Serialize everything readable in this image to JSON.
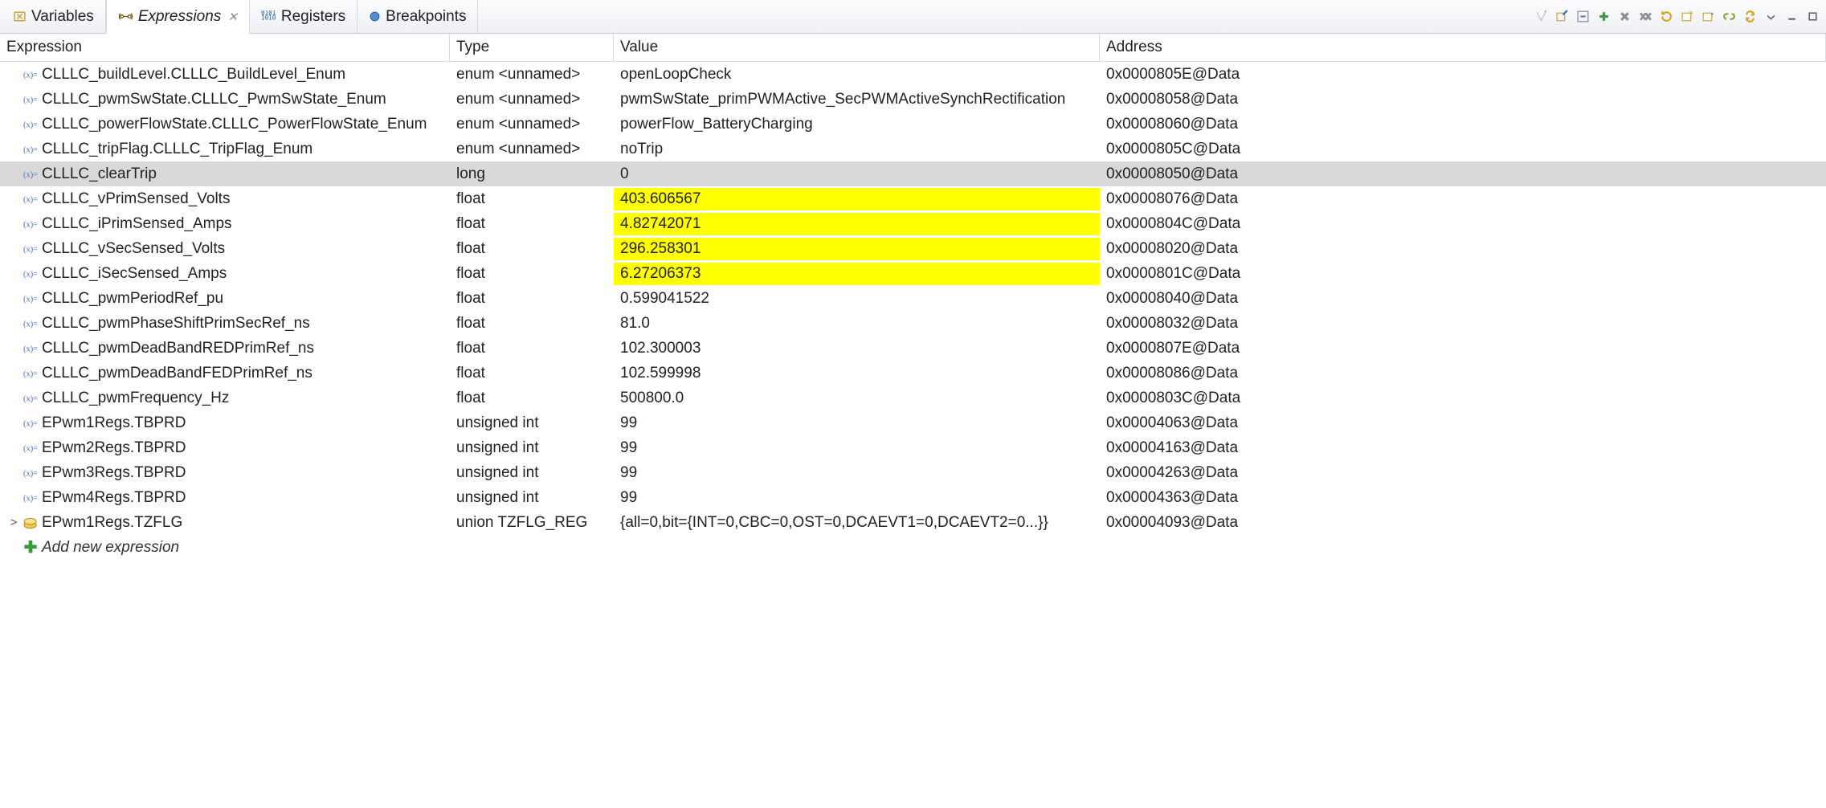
{
  "tabs": {
    "variables": "Variables",
    "expressions": "Expressions",
    "registers": "Registers",
    "breakpoints": "Breakpoints"
  },
  "columns": {
    "expression": "Expression",
    "type": "Type",
    "value": "Value",
    "address": "Address"
  },
  "rows": [
    {
      "icon": "var",
      "expand": "",
      "name": "CLLLC_buildLevel.CLLLC_BuildLevel_Enum",
      "type": "enum <unnamed>",
      "value": "openLoopCheck",
      "addr": "0x0000805E@Data",
      "hl": false,
      "sel": false
    },
    {
      "icon": "var",
      "expand": "",
      "name": "CLLLC_pwmSwState.CLLLC_PwmSwState_Enum",
      "type": "enum <unnamed>",
      "value": "pwmSwState_primPWMActive_SecPWMActiveSynchRectification",
      "addr": "0x00008058@Data",
      "hl": false,
      "sel": false
    },
    {
      "icon": "var",
      "expand": "",
      "name": "CLLLC_powerFlowState.CLLLC_PowerFlowState_Enum",
      "type": "enum <unnamed>",
      "value": "powerFlow_BatteryCharging",
      "addr": "0x00008060@Data",
      "hl": false,
      "sel": false
    },
    {
      "icon": "var",
      "expand": "",
      "name": "CLLLC_tripFlag.CLLLC_TripFlag_Enum",
      "type": "enum <unnamed>",
      "value": "noTrip",
      "addr": "0x0000805C@Data",
      "hl": false,
      "sel": false
    },
    {
      "icon": "var",
      "expand": "",
      "name": "CLLLC_clearTrip",
      "type": "long",
      "value": "0",
      "addr": "0x00008050@Data",
      "hl": false,
      "sel": true
    },
    {
      "icon": "var",
      "expand": "",
      "name": "CLLLC_vPrimSensed_Volts",
      "type": "float",
      "value": "403.606567",
      "addr": "0x00008076@Data",
      "hl": true,
      "sel": false
    },
    {
      "icon": "var",
      "expand": "",
      "name": "CLLLC_iPrimSensed_Amps",
      "type": "float",
      "value": "4.82742071",
      "addr": "0x0000804C@Data",
      "hl": true,
      "sel": false
    },
    {
      "icon": "var",
      "expand": "",
      "name": "CLLLC_vSecSensed_Volts",
      "type": "float",
      "value": "296.258301",
      "addr": "0x00008020@Data",
      "hl": true,
      "sel": false
    },
    {
      "icon": "var",
      "expand": "",
      "name": "CLLLC_iSecSensed_Amps",
      "type": "float",
      "value": "6.27206373",
      "addr": "0x0000801C@Data",
      "hl": true,
      "sel": false
    },
    {
      "icon": "var",
      "expand": "",
      "name": "CLLLC_pwmPeriodRef_pu",
      "type": "float",
      "value": "0.599041522",
      "addr": "0x00008040@Data",
      "hl": false,
      "sel": false
    },
    {
      "icon": "var",
      "expand": "",
      "name": "CLLLC_pwmPhaseShiftPrimSecRef_ns",
      "type": "float",
      "value": "81.0",
      "addr": "0x00008032@Data",
      "hl": false,
      "sel": false
    },
    {
      "icon": "var",
      "expand": "",
      "name": "CLLLC_pwmDeadBandREDPrimRef_ns",
      "type": "float",
      "value": "102.300003",
      "addr": "0x0000807E@Data",
      "hl": false,
      "sel": false
    },
    {
      "icon": "var",
      "expand": "",
      "name": "CLLLC_pwmDeadBandFEDPrimRef_ns",
      "type": "float",
      "value": "102.599998",
      "addr": "0x00008086@Data",
      "hl": false,
      "sel": false
    },
    {
      "icon": "var",
      "expand": "",
      "name": "CLLLC_pwmFrequency_Hz",
      "type": "float",
      "value": "500800.0",
      "addr": "0x0000803C@Data",
      "hl": false,
      "sel": false
    },
    {
      "icon": "var",
      "expand": "",
      "name": "EPwm1Regs.TBPRD",
      "type": "unsigned int",
      "value": "99",
      "addr": "0x00004063@Data",
      "hl": false,
      "sel": false
    },
    {
      "icon": "var",
      "expand": "",
      "name": "EPwm2Regs.TBPRD",
      "type": "unsigned int",
      "value": "99",
      "addr": "0x00004163@Data",
      "hl": false,
      "sel": false
    },
    {
      "icon": "var",
      "expand": "",
      "name": "EPwm3Regs.TBPRD",
      "type": "unsigned int",
      "value": "99",
      "addr": "0x00004263@Data",
      "hl": false,
      "sel": false
    },
    {
      "icon": "var",
      "expand": "",
      "name": "EPwm4Regs.TBPRD",
      "type": "unsigned int",
      "value": "99",
      "addr": "0x00004363@Data",
      "hl": false,
      "sel": false
    },
    {
      "icon": "struct",
      "expand": ">",
      "name": "EPwm1Regs.TZFLG",
      "type": "union TZFLG_REG",
      "value": "{all=0,bit={INT=0,CBC=0,OST=0,DCAEVT1=0,DCAEVT2=0...}}",
      "addr": "0x00004093@Data",
      "hl": false,
      "sel": false
    }
  ],
  "addNew": "Add new expression"
}
